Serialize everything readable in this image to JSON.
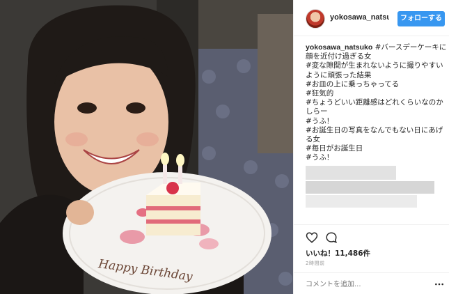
{
  "post": {
    "username": "yokosawa_natsuko",
    "follow_label": "フォローする",
    "caption_user": "yokosawa_natsuko",
    "caption_lines": [
      " #バースデーケーキに",
      "顔を近付け過ぎる女",
      "#変な隙間が生まれないように撮りやすい",
      "ように頑張った結果",
      "#お皿の上に乗っちゃってる",
      "#狂気的",
      "#ちょうどいい距離感はどれくらいなのか",
      "しらー",
      "#うふ！",
      "#お誕生日の写真をなんでもない日にあげ",
      "る女",
      "#毎日がお誕生日",
      "#うふ！"
    ],
    "likes_label": "いいね！11,486件",
    "timestamp": "2時間前",
    "comment_placeholder": "コメントを追加...",
    "cake_plate_text": "Happy Birthday"
  },
  "icons": {
    "like": "heart-icon",
    "comment": "comment-icon",
    "more": "more-options-icon"
  },
  "colors": {
    "follow_button": "#3897f0",
    "text": "#262626",
    "muted": "#999999",
    "divider": "#efefef"
  }
}
